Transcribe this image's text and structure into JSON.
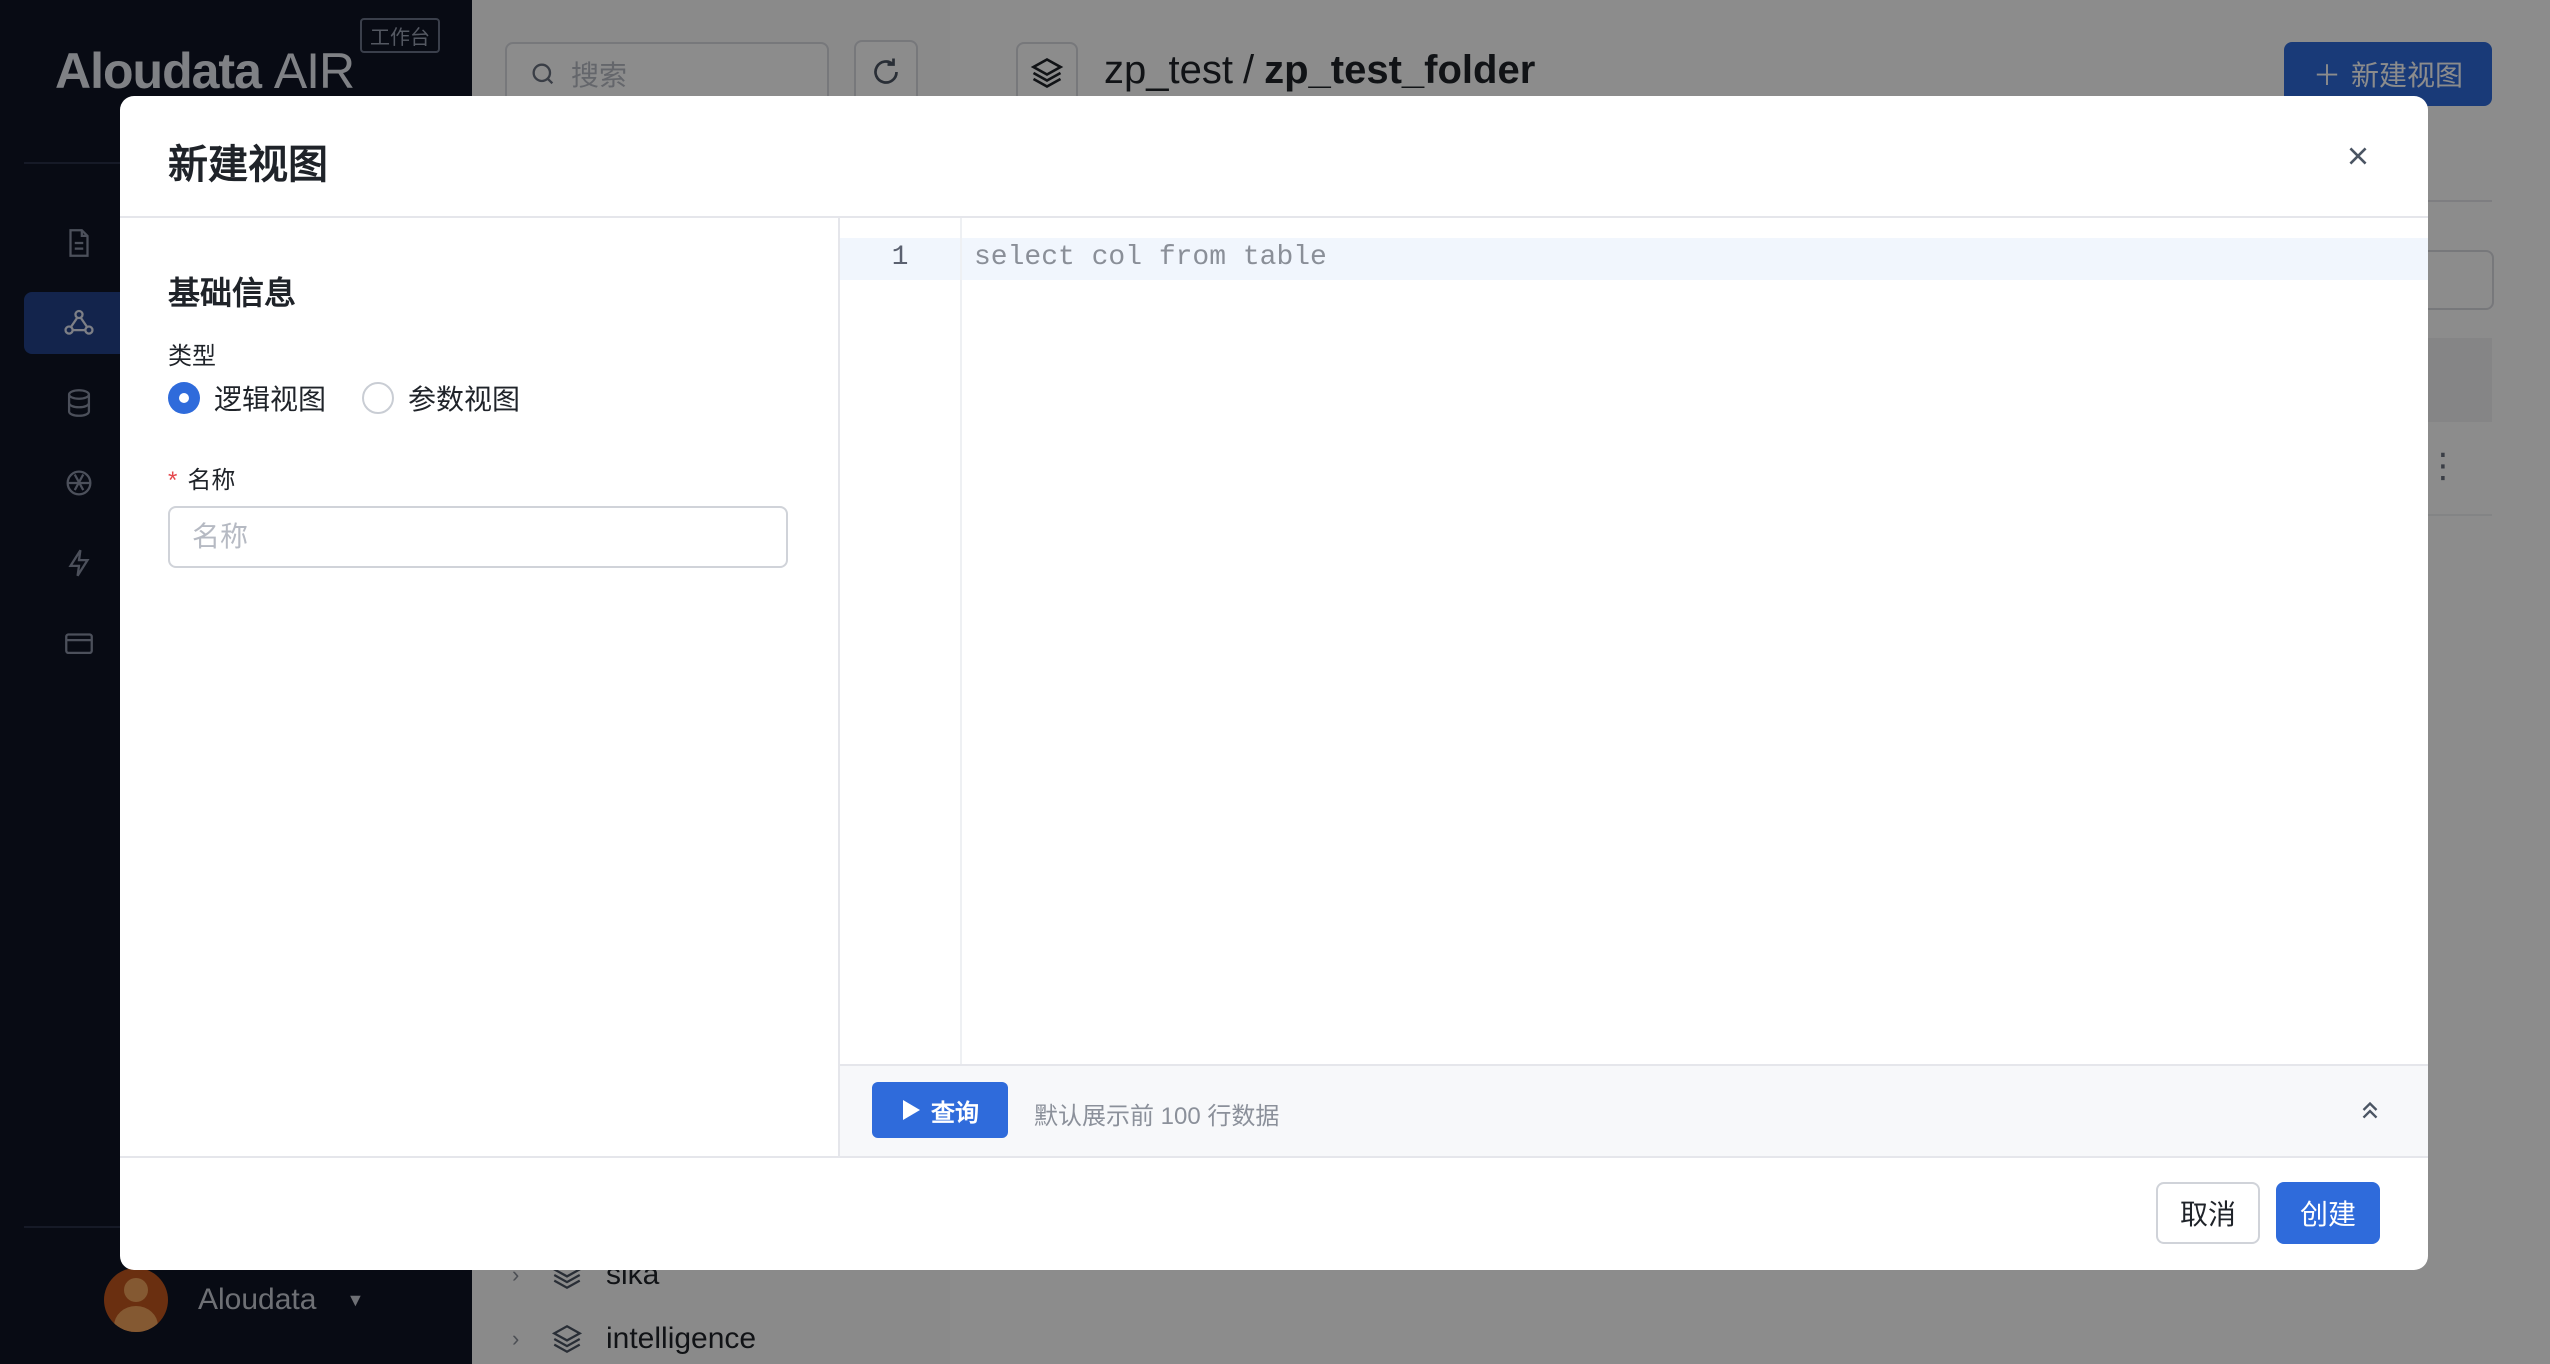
{
  "app": {
    "brand_main": "Aloudata",
    "brand_suffix": "AIR",
    "brand_badge": "工作台",
    "user_name": "Aloudata"
  },
  "sidebar": {
    "nav_icons": [
      "document-icon",
      "model-icon",
      "database-icon",
      "aperture-icon",
      "lightning-icon",
      "card-icon"
    ],
    "active_index": 1
  },
  "tree": {
    "search_placeholder": "搜索",
    "items": [
      {
        "label": "sika"
      },
      {
        "label": "intelligence"
      }
    ]
  },
  "main": {
    "breadcrumb_parent": "zp_test",
    "breadcrumb_separator": "/",
    "breadcrumb_current": "zp_test_folder",
    "new_view_label": "新建视图"
  },
  "modal": {
    "title": "新建视图",
    "section_title": "基础信息",
    "type_label": "类型",
    "type_options": [
      {
        "label": "逻辑视图",
        "checked": true
      },
      {
        "label": "参数视图",
        "checked": false
      }
    ],
    "name_required_mark": "*",
    "name_label": "名称",
    "name_placeholder": "名称",
    "name_value": "",
    "editor": {
      "line_number": "1",
      "code_placeholder": "select col from table"
    },
    "run_label": "查询",
    "run_hint": "默认展示前 100 行数据",
    "cancel_label": "取消",
    "create_label": "创建"
  },
  "colors": {
    "primary": "#2f6bdb",
    "sidebar_bg": "#0f1525",
    "required": "#e5484d"
  }
}
